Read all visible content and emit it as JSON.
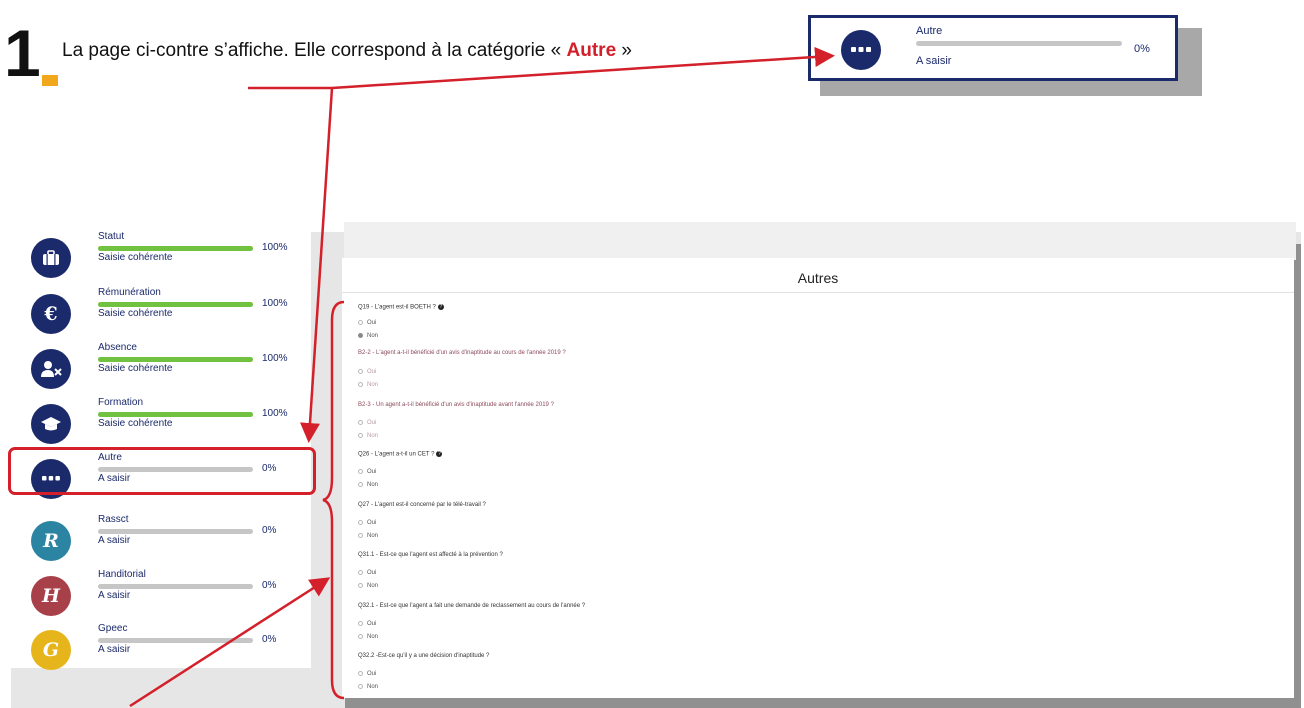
{
  "step": {
    "number": "1",
    "text_before": "La page ci-contre s’affiche. Elle correspond à la catégorie « ",
    "highlight": "Autre",
    "text_after": " »"
  },
  "callout": {
    "name": "Autre",
    "status": "A saisir",
    "percent": "0%",
    "progress": 0,
    "icon": "more-icon"
  },
  "sidebar": {
    "items": [
      {
        "name": "Statut",
        "status": "Saisie cohérente",
        "percent": "100%",
        "progress": 1.0,
        "icon": "briefcase-icon",
        "color": "#1b2a6b",
        "glyph": ""
      },
      {
        "name": "Rémunération",
        "status": "Saisie cohérente",
        "percent": "100%",
        "progress": 1.0,
        "icon": "euro-icon",
        "color": "#1b2a6b",
        "glyph": "€"
      },
      {
        "name": "Absence",
        "status": "Saisie cohérente",
        "percent": "100%",
        "progress": 1.0,
        "icon": "user-x-icon",
        "color": "#1b2a6b",
        "glyph": ""
      },
      {
        "name": "Formation",
        "status": "Saisie cohérente",
        "percent": "100%",
        "progress": 1.0,
        "icon": "graduation-cap-icon",
        "color": "#1b2a6b",
        "glyph": ""
      },
      {
        "name": "Autre",
        "status": "A saisir",
        "percent": "0%",
        "progress": 0,
        "icon": "more-icon",
        "color": "#1b2a6b",
        "glyph": ""
      },
      {
        "name": "Rassct",
        "status": "A saisir",
        "percent": "0%",
        "progress": 0,
        "icon": "rassct-letter-icon",
        "color": "#2a84a2",
        "glyph": "R"
      },
      {
        "name": "Handitorial",
        "status": "A saisir",
        "percent": "0%",
        "progress": 0,
        "icon": "handitorial-letter-icon",
        "color": "#a8404a",
        "glyph": "H"
      },
      {
        "name": "Gpeec",
        "status": "A saisir",
        "percent": "0%",
        "progress": 0,
        "icon": "gpeec-letter-icon",
        "color": "#e6b51c",
        "glyph": "G"
      }
    ]
  },
  "form": {
    "title": "Autres",
    "questions": [
      {
        "text": "Q19 - L'agent est-il BOETH ?",
        "help": true,
        "muted": false,
        "options": [
          "Oui",
          "Non"
        ],
        "selected": 1
      },
      {
        "text": "B2-2 - L'agent a-t-il bénéficié d'un avis d'inaptitude au cours de l'année 2019 ?",
        "help": false,
        "muted": true,
        "options": [
          "Oui",
          "Non"
        ],
        "selected": -1
      },
      {
        "text": "B2-3 - Un agent a-t-il bénéficié d'un avis d'inaptitude avant l'année 2019 ?",
        "help": false,
        "muted": true,
        "options": [
          "Oui",
          "Non"
        ],
        "selected": -1
      },
      {
        "text": "Q26 - L'agent a-t-il un CET ?",
        "help": true,
        "muted": false,
        "options": [
          "Oui",
          "Non"
        ],
        "selected": -1
      },
      {
        "text": "Q27 - L'agent est-il concerné par le télé-travail ?",
        "help": false,
        "muted": false,
        "options": [
          "Oui",
          "Non"
        ],
        "selected": -1
      },
      {
        "text": "Q31.1 - Est-ce que l'agent est affecté à la prévention ?",
        "help": false,
        "muted": false,
        "options": [
          "Oui",
          "Non"
        ],
        "selected": -1
      },
      {
        "text": "Q32.1 - Est-ce que l'agent a fait une demande de reclassement au cours de l'année ?",
        "help": false,
        "muted": false,
        "options": [
          "Oui",
          "Non"
        ],
        "selected": -1
      },
      {
        "text": "Q32.2 -Est-ce qu'il y a une décision d'inaptitude ?",
        "help": false,
        "muted": false,
        "options": [
          "Oui",
          "Non"
        ],
        "selected": -1
      }
    ]
  },
  "colors": {
    "accent": "#d3202a",
    "navy": "#1b2a6b",
    "progress": "#71c240",
    "track": "#c6c6c6"
  }
}
